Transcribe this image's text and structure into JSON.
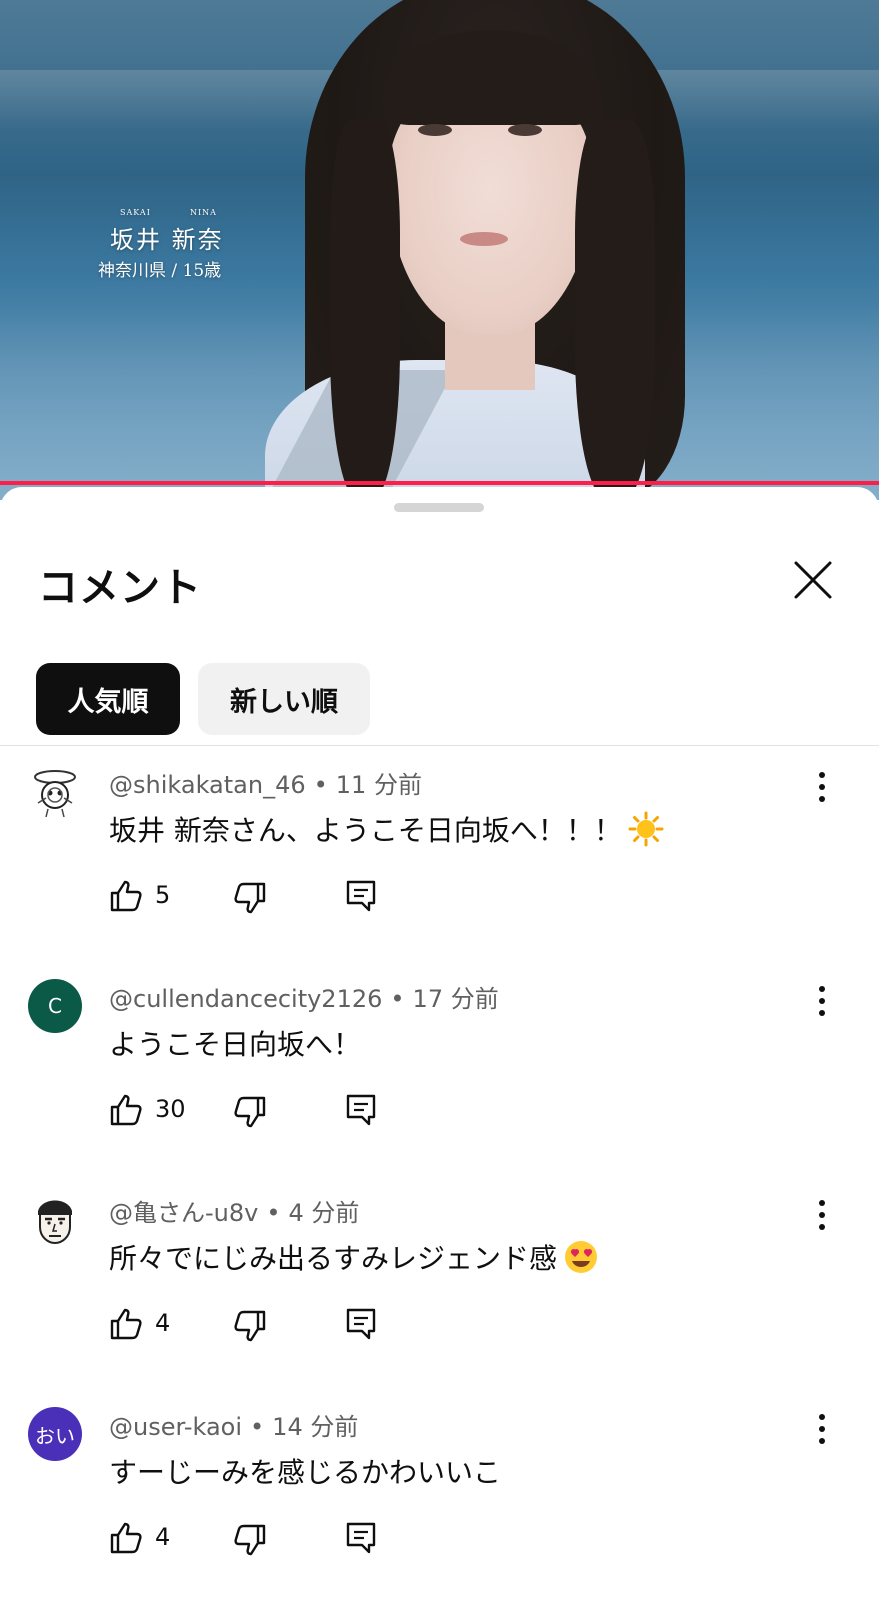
{
  "video": {
    "caption_ruby_family": "SAKAI",
    "caption_ruby_given": "NINA",
    "caption_name": "坂井  新奈",
    "caption_sub": "神奈川県 / 15歳",
    "progress_fraction": 1.0,
    "progress_color": "#ff1e4a"
  },
  "sheet": {
    "title": "コメント",
    "close_icon": "close-icon",
    "sort_chips": [
      {
        "label": "人気順",
        "selected": true
      },
      {
        "label": "新しい順",
        "selected": false
      }
    ]
  },
  "comments": [
    {
      "handle": "@shikakatan_46",
      "time": "11 分前",
      "text": "坂井 新奈さん、ようこそ日向坂へ！！！",
      "emoji": "sun-emoji",
      "likes": "5",
      "avatar": {
        "type": "image",
        "icon": "cartoon-avatar"
      }
    },
    {
      "handle": "@cullendancecity2126",
      "time": "17 分前",
      "text": "ようこそ日向坂へ！",
      "emoji": "",
      "likes": "30",
      "avatar": {
        "type": "letter",
        "letter": "C",
        "color": "#0b5a48"
      }
    },
    {
      "handle": "@亀さん-u8v",
      "time": "4 分前",
      "text": "所々でにじみ出るすみレジェンド感",
      "emoji": "heart-eyes-emoji",
      "likes": "4",
      "avatar": {
        "type": "image",
        "icon": "manga-face-avatar"
      }
    },
    {
      "handle": "@user-kaoi",
      "time": "14 分前",
      "text": "すーじーみを感じるかわいいこ",
      "emoji": "",
      "likes": "4",
      "avatar": {
        "type": "letter",
        "letter": "おい",
        "color": "#4a2fb8"
      }
    }
  ],
  "colors": {
    "text_primary": "#0f0f0f",
    "text_secondary": "#606060",
    "chip_active_bg": "#0f0f0f",
    "chip_inactive_bg": "#f1f1f1"
  }
}
